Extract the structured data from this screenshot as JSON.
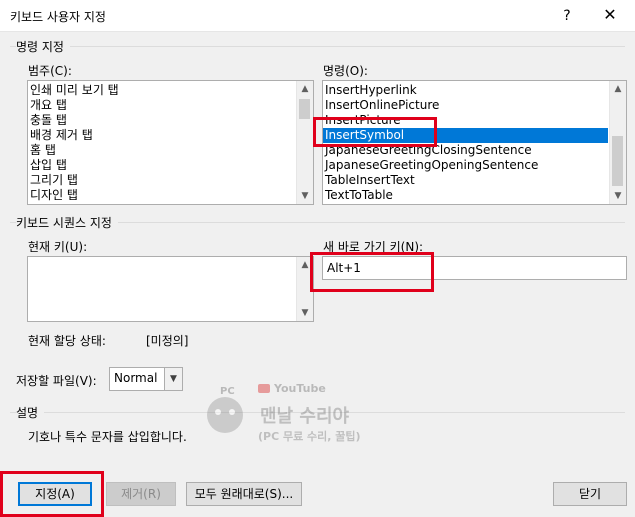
{
  "window": {
    "title": "키보드 사용자 지정",
    "help": "?",
    "close": "✕"
  },
  "commands_group": {
    "label": "명령 지정",
    "category_label": "범주(C):",
    "categories": [
      "인쇄 미리 보기 탭",
      "개요 탭",
      "충돌 탭",
      "배경 제거 탭",
      "홈 탭",
      "삽입 탭",
      "그리기 탭",
      "디자인 탭"
    ],
    "command_label": "명령(O):",
    "commands": [
      "InsertHyperlink",
      "InsertOnlinePicture",
      "InsertPicture",
      "InsertSymbol",
      "JapaneseGreetingClosingSentence",
      "JapaneseGreetingOpeningSentence",
      "TableInsertText",
      "TextToTable"
    ],
    "selected_command": "InsertSymbol"
  },
  "keys_group": {
    "label": "키보드 시퀀스 지정",
    "current_keys_label": "현재 키(U):",
    "new_key_label": "새 바로 가기 키(N):",
    "new_key_value": "Alt+1",
    "assign_status_label": "현재 할당 상태:",
    "assign_status_value": "[미정의]"
  },
  "save": {
    "label": "저장할 파일(V):",
    "value": "Normal"
  },
  "description": {
    "label": "설명",
    "text": "기호나 특수 문자를 삽입합니다."
  },
  "buttons": {
    "assign": "지정(A)",
    "remove": "제거(R)",
    "reset_all": "모두 원래대로(S)...",
    "close": "닫기"
  },
  "watermark": {
    "pc": "PC",
    "youtube": "YouTube",
    "channel": "맨날 수리야",
    "subtitle": "(PC 무료 수리, 꿀팁)"
  },
  "colors": {
    "selection": "#0078d7",
    "highlight_box": "#e0001b"
  }
}
